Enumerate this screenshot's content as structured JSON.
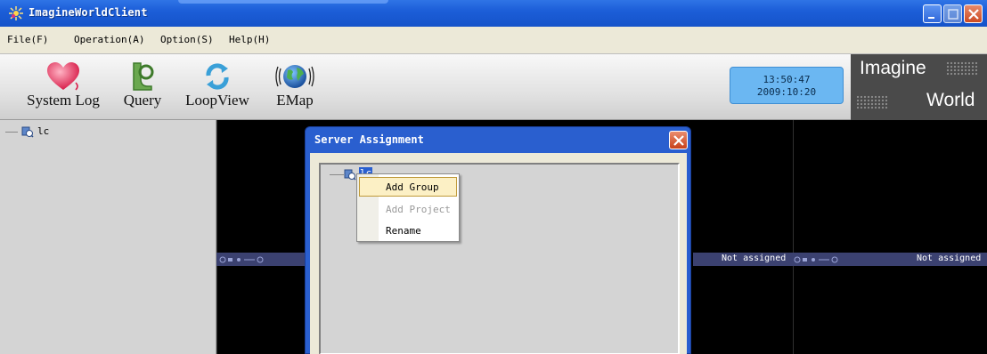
{
  "window": {
    "title": "ImagineWorldClient"
  },
  "menu": {
    "items": [
      "File(F)",
      "Operation(A)",
      "Option(S)",
      "Help(H)"
    ]
  },
  "toolbar": {
    "items": [
      {
        "label": "System Log",
        "icon": "heart-icon"
      },
      {
        "label": "Query",
        "icon": "query-icon"
      },
      {
        "label": "LoopView",
        "icon": "refresh-icon"
      },
      {
        "label": "EMap",
        "icon": "globe-icon"
      }
    ],
    "clock": {
      "time": "13:50:47",
      "date": "2009:10:20"
    },
    "brand": {
      "line1": "Imagine",
      "line2": "World"
    }
  },
  "tree": {
    "root_label": "lc"
  },
  "video": {
    "status_labels": [
      "Not assigned",
      "Not assigned"
    ]
  },
  "dialog": {
    "title": "Server Assignment",
    "tree_root_label": "lc",
    "context_menu": [
      {
        "label": "Add Group",
        "state": "highlighted"
      },
      {
        "label": "Add Project",
        "state": "disabled"
      },
      {
        "label": "Rename",
        "state": "normal"
      }
    ]
  },
  "colors": {
    "titlebar": "#1c5ed8",
    "clock_bg": "#6bb7f2",
    "status_bar": "#3b4170",
    "menu_highlight": "#fcf0c5"
  }
}
